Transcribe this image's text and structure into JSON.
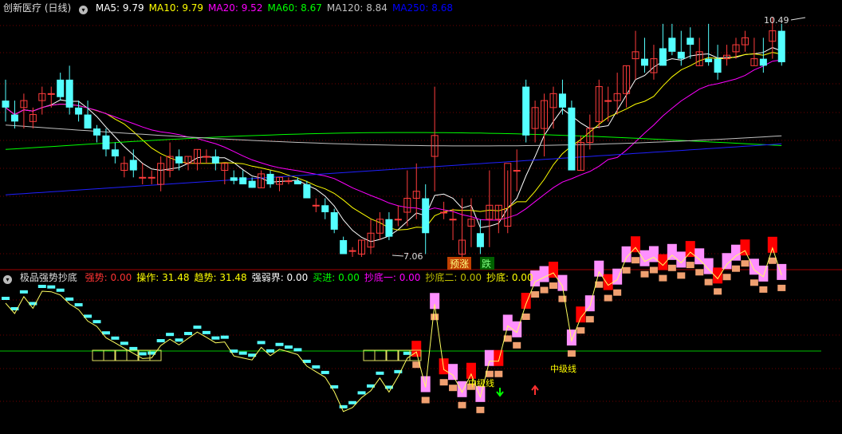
{
  "top_header": {
    "title": "创新医疗 (日线)",
    "items": [
      {
        "label": "MA5:",
        "value": "9.79",
        "color": "#ffffff"
      },
      {
        "label": "MA10:",
        "value": "9.79",
        "color": "#ffff00"
      },
      {
        "label": "MA20:",
        "value": "9.52",
        "color": "#ff00ff"
      },
      {
        "label": "MA60:",
        "value": "8.67",
        "color": "#00ff00"
      },
      {
        "label": "MA120:",
        "value": "8.84",
        "color": "#c0c0c0"
      },
      {
        "label": "MA250:",
        "value": "8.68",
        "color": "#0000ff"
      }
    ]
  },
  "bottom_header": {
    "title": "极品强势抄底",
    "items": [
      {
        "label": "强势:",
        "value": "0.00",
        "color": "#ff3333"
      },
      {
        "label": "操作:",
        "value": "31.48",
        "color": "#ffff00"
      },
      {
        "label": "趋势:",
        "value": "31.48",
        "color": "#ffff00"
      },
      {
        "label": "强弱界:",
        "value": "0.00",
        "color": "#ffffff"
      },
      {
        "label": "买进:",
        "value": "0.00",
        "color": "#00ff00"
      },
      {
        "label": "抄底一:",
        "value": "0.00",
        "color": "#ff00ff"
      },
      {
        "label": "抄底二:",
        "value": "0.00",
        "color": "#c0c000"
      },
      {
        "label": "抄底:",
        "value": "0.00",
        "color": "#ffff00"
      }
    ]
  },
  "annotations": {
    "high_label": "10.49",
    "low_label": "7.06",
    "tag_rise": "预涨",
    "tag_fall": "跌",
    "mid_text_1": "中级线",
    "mid_text_2": "中级线"
  },
  "chart_data": [
    {
      "type": "candlestick",
      "candles": [
        [
          9.3,
          9.6,
          9.0,
          9.2
        ],
        [
          9.1,
          9.3,
          8.9,
          9.0
        ],
        [
          9.2,
          9.4,
          8.9,
          9.3
        ],
        [
          9.0,
          9.2,
          8.9,
          9.1
        ],
        [
          9.3,
          9.5,
          9.1,
          9.4
        ],
        [
          9.4,
          9.5,
          9.2,
          9.4
        ],
        [
          9.6,
          9.7,
          9.3,
          9.35
        ],
        [
          9.6,
          9.8,
          9.1,
          9.2
        ],
        [
          9.2,
          9.3,
          9.0,
          9.1
        ],
        [
          9.1,
          9.3,
          8.9,
          8.9
        ],
        [
          8.9,
          8.95,
          8.7,
          8.8
        ],
        [
          8.8,
          8.9,
          8.5,
          8.6
        ],
        [
          8.6,
          8.7,
          8.4,
          8.5
        ],
        [
          8.3,
          8.5,
          8.2,
          8.4
        ],
        [
          8.45,
          8.6,
          8.2,
          8.3
        ],
        [
          8.2,
          8.4,
          8.1,
          8.2
        ],
        [
          8.2,
          8.3,
          8.1,
          8.2
        ],
        [
          8.1,
          8.5,
          8.0,
          8.4
        ],
        [
          8.3,
          8.7,
          8.2,
          8.5
        ],
        [
          8.5,
          8.6,
          8.3,
          8.4
        ],
        [
          8.4,
          8.5,
          8.3,
          8.5
        ],
        [
          8.4,
          8.6,
          8.3,
          8.6
        ],
        [
          8.5,
          8.6,
          8.4,
          8.5
        ],
        [
          8.5,
          8.6,
          8.3,
          8.4
        ],
        [
          8.3,
          8.4,
          8.1,
          8.4
        ],
        [
          8.2,
          8.3,
          8.1,
          8.15
        ],
        [
          8.2,
          8.3,
          8.1,
          8.1
        ],
        [
          8.15,
          8.2,
          8.05,
          8.05
        ],
        [
          8.05,
          8.3,
          8.05,
          8.25
        ],
        [
          8.25,
          8.3,
          8.05,
          8.1
        ],
        [
          8.1,
          8.2,
          8.0,
          8.2
        ],
        [
          8.15,
          8.2,
          8.1,
          8.15
        ],
        [
          8.15,
          8.2,
          8.1,
          8.1
        ],
        [
          8.1,
          8.15,
          7.95,
          7.9
        ],
        [
          7.8,
          7.9,
          7.7,
          7.8
        ],
        [
          7.8,
          7.9,
          7.6,
          7.7
        ],
        [
          7.7,
          7.75,
          7.4,
          7.45
        ],
        [
          7.3,
          7.35,
          7.1,
          7.1
        ],
        [
          7.15,
          7.2,
          7.06,
          7.15
        ],
        [
          7.1,
          7.3,
          7.06,
          7.3
        ],
        [
          7.2,
          7.6,
          7.1,
          7.4
        ],
        [
          7.4,
          7.7,
          7.3,
          7.6
        ],
        [
          7.6,
          7.7,
          7.3,
          7.35
        ],
        [
          7.6,
          7.8,
          7.5,
          7.6
        ],
        [
          7.7,
          8.3,
          7.5,
          7.9
        ],
        [
          7.9,
          8.4,
          7.6,
          8.0
        ],
        [
          7.9,
          8.1,
          7.1,
          7.4
        ],
        [
          8.5,
          9.5,
          8.0,
          8.8
        ],
        [
          7.7,
          7.85,
          7.6,
          7.7
        ],
        [
          7.6,
          7.75,
          7.3,
          7.6
        ],
        [
          7.1,
          7.9,
          6.9,
          7.3
        ],
        [
          7.5,
          7.9,
          7.2,
          7.6
        ],
        [
          7.4,
          7.6,
          7.1,
          7.2
        ],
        [
          7.6,
          8.3,
          7.2,
          7.8
        ],
        [
          7.6,
          7.8,
          7.4,
          7.8
        ],
        [
          7.5,
          8.3,
          7.4,
          8.4
        ],
        [
          8.3,
          8.6,
          8.0,
          8.3
        ],
        [
          9.5,
          9.6,
          8.7,
          8.8
        ],
        [
          8.9,
          9.3,
          8.7,
          9.2
        ],
        [
          8.9,
          9.4,
          8.5,
          9.3
        ],
        [
          9.2,
          9.5,
          8.9,
          9.4
        ],
        [
          9.4,
          9.6,
          9.1,
          9.2
        ],
        [
          9.2,
          9.3,
          8.3,
          8.3
        ],
        [
          8.3,
          8.8,
          8.3,
          8.7
        ],
        [
          8.7,
          9.1,
          8.6,
          8.9
        ],
        [
          9.0,
          9.6,
          8.9,
          9.5
        ],
        [
          9.3,
          9.5,
          9.0,
          9.3
        ],
        [
          9.3,
          9.7,
          9.1,
          9.4
        ],
        [
          9.4,
          9.8,
          9.2,
          9.8
        ],
        [
          9.9,
          10.3,
          9.6,
          10.0
        ],
        [
          9.9,
          10.2,
          9.7,
          9.8
        ],
        [
          9.7,
          10.1,
          9.6,
          9.9
        ],
        [
          10.05,
          10.4,
          9.8,
          9.8
        ],
        [
          10.2,
          10.4,
          9.95,
          10.0
        ],
        [
          10.0,
          10.3,
          9.8,
          9.9
        ],
        [
          10.2,
          10.35,
          9.9,
          10.1
        ],
        [
          9.8,
          10.2,
          9.8,
          10.0
        ],
        [
          9.9,
          10.4,
          9.8,
          9.85
        ],
        [
          9.9,
          10.1,
          9.6,
          9.7
        ],
        [
          9.9,
          10.1,
          9.8,
          9.95
        ],
        [
          10.0,
          10.2,
          9.9,
          10.1
        ],
        [
          10.1,
          10.3,
          10.0,
          10.2
        ],
        [
          9.8,
          10.2,
          9.8,
          9.9
        ],
        [
          9.9,
          10.2,
          9.7,
          9.8
        ],
        [
          10.15,
          10.49,
          9.9,
          10.3
        ],
        [
          10.3,
          10.4,
          9.8,
          9.85
        ]
      ]
    },
    {
      "type": "indicator",
      "bars": [],
      "line": []
    }
  ]
}
